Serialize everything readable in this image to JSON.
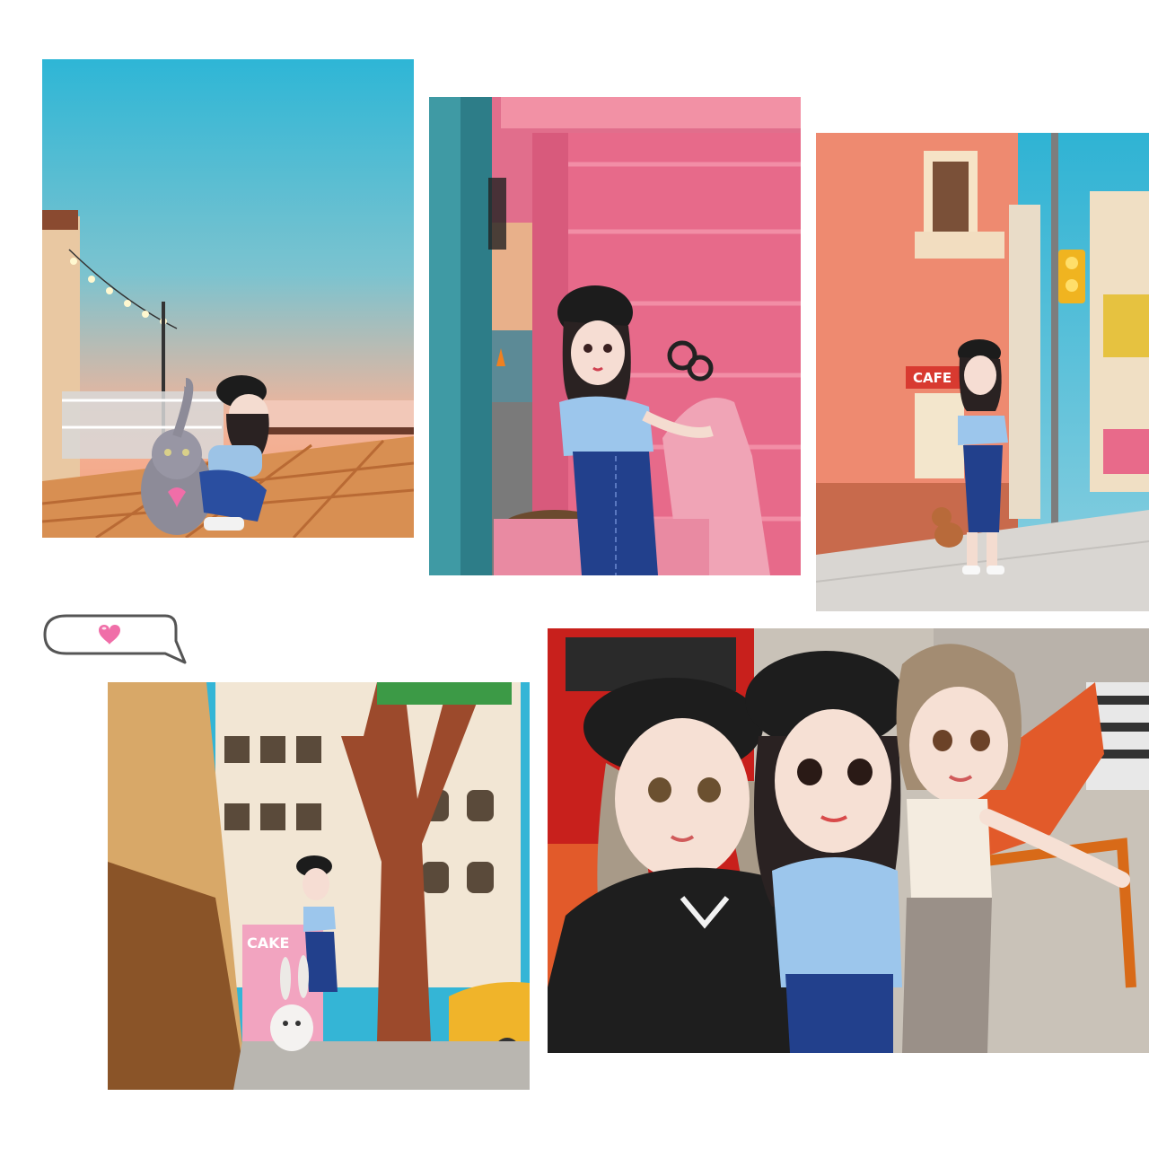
{
  "collage": {
    "photo1": {
      "scene": "rooftop"
    },
    "photo2": {
      "scene": "pink-wall-scooter"
    },
    "photo3": {
      "scene": "city-corner-cafe",
      "sign_text": "CAFE"
    },
    "photo4": {
      "scene": "alley-street",
      "sign_text": "CAKE"
    },
    "photo5": {
      "scene": "three-friends-selfie"
    }
  },
  "bubble": {
    "icon": "heart-icon"
  },
  "colors": {
    "sky_top": "#2eb6d6",
    "sky_bottom": "#f4a888",
    "pink_wall": "#e06b8a",
    "salmon_building": "#ee8a70",
    "heart": "#f06ea8",
    "red_booth": "#c8201c"
  }
}
